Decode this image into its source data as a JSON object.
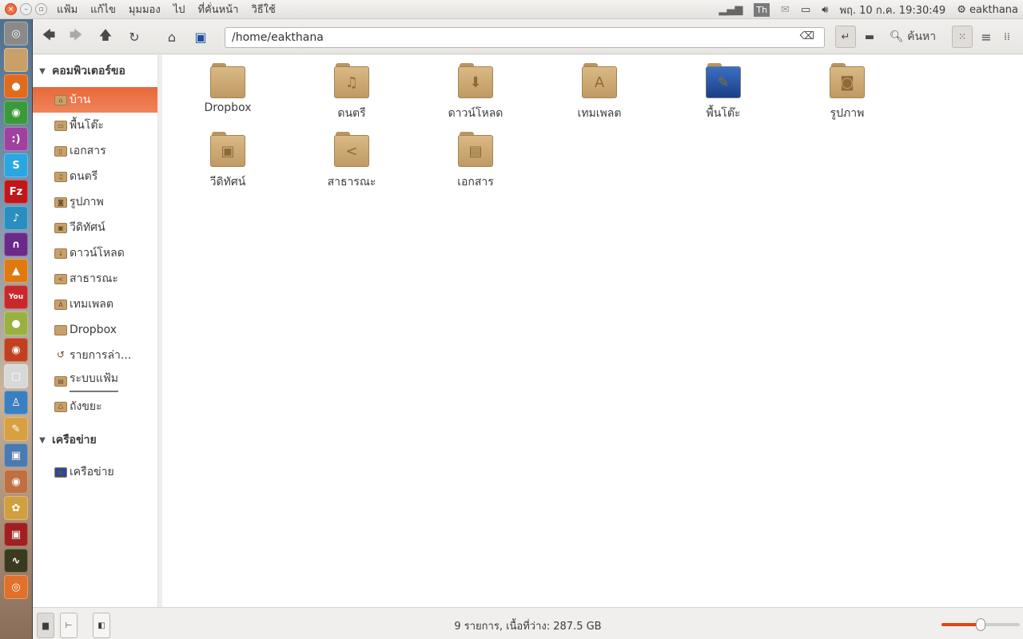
{
  "panel": {
    "menus": [
      "แฟ้ม",
      "แก้ไข",
      "มุมมอง",
      "ไป",
      "ที่คั่นหน้า",
      "วิธีใช้"
    ],
    "keyboard": "Th",
    "datetime": "พฤ. 10 ก.ค. 19:30:49",
    "user": "eakthana"
  },
  "launcher": [
    {
      "name": "dash",
      "c": "#8a8a8a",
      "g": "◎"
    },
    {
      "name": "files",
      "c": "#c9a06a",
      "g": ""
    },
    {
      "name": "firefox",
      "c": "#e06a1e",
      "g": "●"
    },
    {
      "name": "chrome",
      "c": "#3a9a3a",
      "g": "◉"
    },
    {
      "name": "empathy",
      "c": "#a040a0",
      "g": ":)"
    },
    {
      "name": "skype",
      "c": "#2aa6e0",
      "g": "S"
    },
    {
      "name": "filezilla",
      "c": "#c0181a",
      "g": "Fz"
    },
    {
      "name": "music",
      "c": "#2a8ec0",
      "g": "♪"
    },
    {
      "name": "headphones",
      "c": "#6a2a8a",
      "g": "∩"
    },
    {
      "name": "vlc",
      "c": "#e07a10",
      "g": "▲"
    },
    {
      "name": "youtube",
      "c": "#c8282a",
      "g": "You"
    },
    {
      "name": "app",
      "c": "#9ab040",
      "g": "●"
    },
    {
      "name": "disc-burner",
      "c": "#c04020",
      "g": "◉"
    },
    {
      "name": "libreoffice",
      "c": "#d8d8d8",
      "g": "▢"
    },
    {
      "name": "app2",
      "c": "#3a80c0",
      "g": "♙"
    },
    {
      "name": "text-editor",
      "c": "#d8a040",
      "g": "✎"
    },
    {
      "name": "screenshot",
      "c": "#4a7ab0",
      "g": "▣"
    },
    {
      "name": "eye",
      "c": "#c07040",
      "g": "◉"
    },
    {
      "name": "paint",
      "c": "#d0a040",
      "g": "✿"
    },
    {
      "name": "app3",
      "c": "#a02020",
      "g": "▣"
    },
    {
      "name": "monitor",
      "c": "#3a3a20",
      "g": "∿"
    },
    {
      "name": "ubuntu-one",
      "c": "#e0702a",
      "g": "◎"
    }
  ],
  "toolbar": {
    "path": "/home/eakthana",
    "search": "ค้นหา"
  },
  "sidebar": {
    "computer_header": "คอมพิวเตอร์ขอ",
    "network_header": "เครือข่าย",
    "items": [
      {
        "label": "บ้าน",
        "icon": "⌂",
        "selected": true
      },
      {
        "label": "พื้นโต๊ะ",
        "icon": "▭"
      },
      {
        "label": "เอกสาร",
        "icon": "▯"
      },
      {
        "label": "ดนตรี",
        "icon": "♫"
      },
      {
        "label": "รูปภาพ",
        "icon": "◙"
      },
      {
        "label": "วีดิทัศน์",
        "icon": "▣"
      },
      {
        "label": "ดาวน์โหลด",
        "icon": "↓"
      },
      {
        "label": "สาธารณะ",
        "icon": "<"
      },
      {
        "label": "เทมเพลต",
        "icon": "A"
      },
      {
        "label": "Dropbox",
        "icon": ""
      },
      {
        "label": "รายการล่า...",
        "icon": "↺"
      },
      {
        "label": "ระบบแฟ้ม",
        "icon": "▤"
      },
      {
        "label": "ถังขยะ",
        "icon": "♺"
      }
    ],
    "network_items": [
      {
        "label": "เครือข่าย",
        "icon": "▪"
      }
    ]
  },
  "files": [
    {
      "label": "Dropbox",
      "g": ""
    },
    {
      "label": "ดนตรี",
      "g": "♫"
    },
    {
      "label": "ดาวน์โหลด",
      "g": "⬇"
    },
    {
      "label": "เทมเพลต",
      "g": "A"
    },
    {
      "label": "พื้นโต๊ะ",
      "g": "✎",
      "desk": true
    },
    {
      "label": "รูปภาพ",
      "g": "◙"
    },
    {
      "label": "วีดิทัศน์",
      "g": "▣"
    },
    {
      "label": "สาธารณะ",
      "g": "<"
    },
    {
      "label": "เอกสาร",
      "g": "▤"
    }
  ],
  "status": {
    "text": "9 รายการ, เนื้อที่ว่าง: 287.5 GB",
    "zoom_percent": 50
  }
}
